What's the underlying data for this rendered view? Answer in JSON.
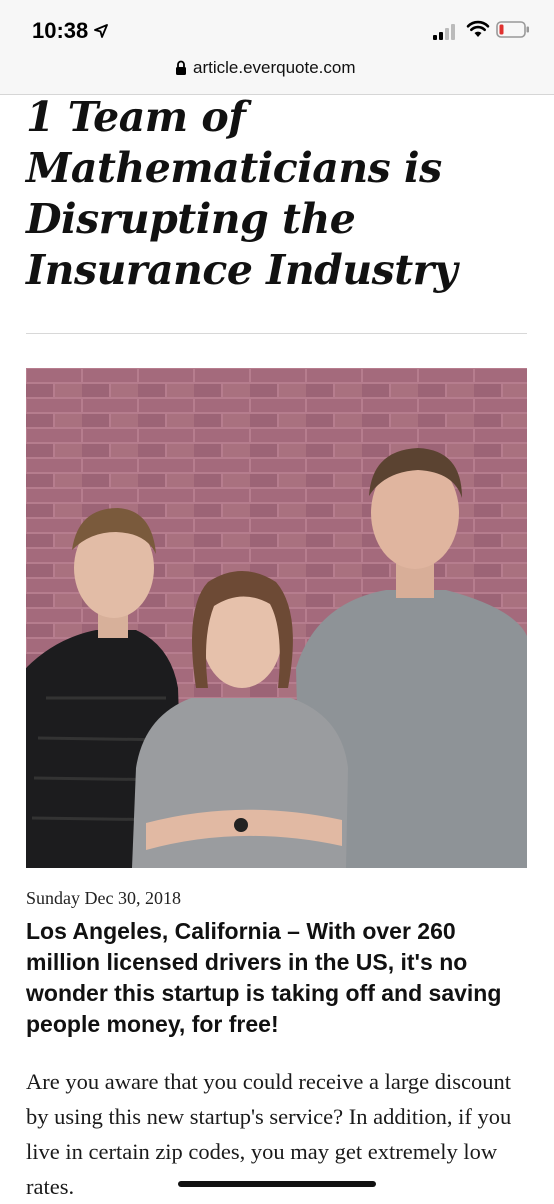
{
  "status_bar": {
    "time": "10:38"
  },
  "browser": {
    "url": "article.everquote.com"
  },
  "article": {
    "headline": "1 Team of Mathematicians is Disrupting the Insurance Industry",
    "date": "Sunday Dec 30, 2018",
    "subheadline": "Los Angeles, California – With over 260 million licensed drivers in the US, it's no wonder this startup is taking off and saving people money, for free!",
    "body": "Are you aware that you could receive a large discount by using this new startup's service? In addition, if you live in certain zip codes, you may get extremely low rates."
  },
  "icons": {
    "location": "location-arrow-icon",
    "signal": "cellular-signal-icon",
    "wifi": "wifi-icon",
    "battery": "battery-low-icon",
    "lock": "lock-icon"
  },
  "colors": {
    "battery_low": "#e0312f",
    "brick_wall": "#a46a7c",
    "status_bar_bg": "#f7f7f7"
  }
}
